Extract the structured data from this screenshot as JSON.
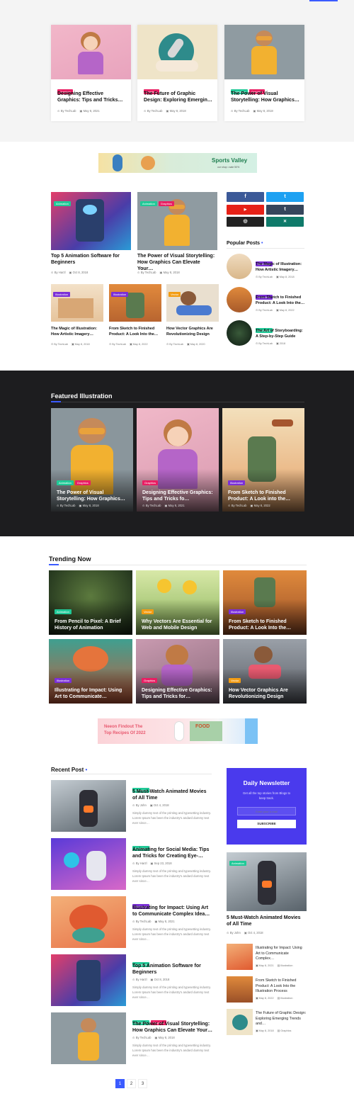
{
  "colors": {
    "accent": "#3b5bff",
    "animation": "#20c997",
    "graphics": "#e91e63",
    "illustration": "#7b2fd8",
    "vector": "#f39c12",
    "dark": "#1d1d1f",
    "newsletter": "#4a3aed"
  },
  "tags": {
    "graphics": "Graphics",
    "animation": "Animation",
    "illustration": "Illustration",
    "vector": "Vector"
  },
  "top_cards": [
    {
      "tag": "Graphics",
      "title": "Designing Effective Graphics: Tips and Tricks…",
      "author": "By TechLab",
      "date": "May 8, 2021"
    },
    {
      "tag": "Graphics",
      "title": "The Future of Graphic Design: Exploring Emergin…",
      "author": "By TechLab",
      "date": "May 8, 2018"
    },
    {
      "tag": "Animation",
      "tag2": "Graphics",
      "title": "The Power of Visual Storytelling: How Graphics…",
      "author": "By TechLab",
      "date": "May 8, 2018"
    }
  ],
  "banner1": {
    "title": "Sports Valley",
    "sub": "our shop • sale 50%"
  },
  "grid_big": [
    {
      "tag": "Animation",
      "title": "Top 5 Animation Software for Beginners",
      "author": "By Harzl",
      "date": "Oct 8, 2018"
    },
    {
      "tag": "Animation",
      "tag2": "Graphics",
      "title": "The Power of Visual Storytelling: How Graphics Can Elevate Your…",
      "author": "By TechLab",
      "date": "May 8, 2018"
    }
  ],
  "grid_small": [
    {
      "tag": "Illustration",
      "title": "The Magic of Illustration: How Artistic Imagery…",
      "author": "By TechLab",
      "date": "May 8, 2018"
    },
    {
      "tag": "Illustration",
      "title": "From Sketch to Finished Product: A Look Into the…",
      "author": "By TechLab",
      "date": "May 8, 2022"
    },
    {
      "tag": "Vector",
      "title": "How Vector Graphics Are Revolutionizing Design",
      "author": "By TechLab",
      "date": "May 8, 2020"
    }
  ],
  "social": {
    "fb": "f",
    "tw": "t",
    "yt": "▶",
    "tb": "t",
    "ig": "◎",
    "xg": "✕"
  },
  "popular": {
    "heading": "Popular Posts",
    "items": [
      {
        "tag": "Illustration",
        "title": "The Magic of Illustration: How Artistic Imagery…",
        "author": "By TechLab",
        "date": "May 8, 2018"
      },
      {
        "tag": "Illustration",
        "title": "From Sketch to Finished Product: A Look Into the…",
        "author": "By TechLab",
        "date": "May 8, 2022"
      },
      {
        "tag": "Animation",
        "title": "The Art of Storyboarding: A Step-by-Step Guide",
        "author": "By TechLab",
        "date": "2018"
      }
    ]
  },
  "featured": {
    "heading": "Featured Illustration",
    "items": [
      {
        "tag": "Animation",
        "tag2": "Graphics",
        "title": "The Power of Visual Storytelling: How Graphics…",
        "author": "By TechLab",
        "date": "May 8, 2018"
      },
      {
        "tag": "Graphics",
        "title": "Designing Effective Graphics: Tips and Tricks fo…",
        "author": "By TechLab",
        "date": "May 8, 2021"
      },
      {
        "tag": "Illustration",
        "title": "From Sketch to Finished Product: A Look into the…",
        "author": "By TechLab",
        "date": "May 8, 2022"
      }
    ]
  },
  "trending": {
    "heading": "Trending Now",
    "items": [
      {
        "tag": "Animation",
        "title": "From Pencil to Pixel: A Brief History of Animation"
      },
      {
        "tag": "Vector",
        "title": "Why Vectors Are Essential for Web and Mobile Design"
      },
      {
        "tag": "Illustration",
        "title": "From Sketch to Finished Product: A Look Into the…"
      },
      {
        "tag": "Illustration",
        "title": "Illustrating for Impact: Using Art to Communicate…"
      },
      {
        "tag": "Graphics",
        "title": "Designing Effective Graphics: Tips and Tricks for…"
      },
      {
        "tag": "Vector",
        "title": "How Vector Graphics Are Revolutionizing Design"
      }
    ]
  },
  "banner2": {
    "line1": "Neeon Findout The",
    "line2": "Top Recipes Of 2022",
    "food": "FOOD"
  },
  "recent": {
    "heading": "Recent Post",
    "excerpt": "Simply dummy text of the printing and typesetting industry. Lorem Ipsum has been the industry's andard dummy text ever since…",
    "items": [
      {
        "tag": "Animation",
        "title": "5 Must-Watch Animated Movies of All Time",
        "author": "By John",
        "date": "Oct 4, 2018"
      },
      {
        "tag": "Animation",
        "title": "Animating for Social Media: Tips and Tricks for Creating Eye-…",
        "author": "By Harzl",
        "date": "Sep 23, 2018"
      },
      {
        "tag": "Illustration",
        "title": "Illustrating for Impact: Using Art to Communicate Complex Idea…",
        "author": "By TechLab",
        "date": "May 8, 2021"
      },
      {
        "tag": "Animation",
        "title": "Top 5 Animation Software for Beginners",
        "author": "By Harzl",
        "date": "Oct 8, 2018"
      },
      {
        "tag": "Animation",
        "tag2": "Graphics",
        "title": "The Power of Visual Storytelling: How Graphics Can Elevate Your…",
        "author": "By TechLab",
        "date": "May 8, 2018"
      }
    ]
  },
  "newsletter": {
    "title": "Daily Newsletter",
    "text": "Get all the top stories from Blogs to keep track.",
    "placeholder": "Enter your e-mail",
    "button": "SUBSCRIBE"
  },
  "side_feature": {
    "tag": "Animation",
    "title": "5 Must-Watch Animated Movies of All Time",
    "author": "By John",
    "date": "Oct 4, 2018"
  },
  "side_list": [
    {
      "title": "Illustrating for Impact: Using Art to Communicate Complex…",
      "date": "May 8, 2021",
      "cat": "Illustration"
    },
    {
      "title": "From Sketch to Finished Product: A Look Into the Illustration Process",
      "date": "May 8, 2022",
      "cat": "Illustration"
    },
    {
      "title": "The Future of Graphic Design: Exploring Emerging Trends and…",
      "date": "May 8, 2018",
      "cat": "Graphics"
    }
  ],
  "pagination": [
    "1",
    "2",
    "3"
  ]
}
